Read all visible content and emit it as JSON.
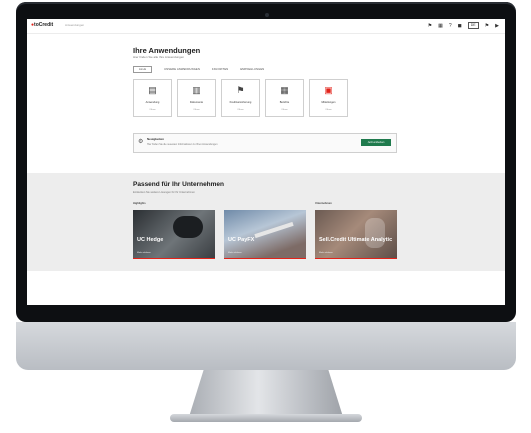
{
  "header": {
    "logo_mark": "●",
    "logo_text": "toCredit",
    "breadcrumb": "Anwendungen",
    "icons": [
      "flag-icon",
      "grid-icon",
      "help-icon",
      "account-icon"
    ],
    "icon_glyphs": [
      "⚑",
      "▦",
      "?",
      "◼"
    ],
    "language": "DE",
    "extra_glyphs": [
      "⚑",
      "▶"
    ]
  },
  "main": {
    "title": "Ihre Anwendungen",
    "subtitle": "Hier finden Sie alle Ihre Anwendungen",
    "tabs": [
      "ALLE",
      "UNSERE ANWENDUNGEN",
      "FAVORITEN",
      "EMPFEHLUNGEN"
    ],
    "cards": [
      {
        "name": "Anwendung",
        "meta": "Öffnen",
        "glyph": "▤"
      },
      {
        "name": "Dokumente",
        "meta": "Öffnen",
        "glyph": "▥"
      },
      {
        "name": "Kreditversicherung",
        "meta": "Öffnen",
        "glyph": "⚑"
      },
      {
        "name": "Berichte",
        "meta": "Öffnen",
        "glyph": "▦"
      },
      {
        "name": "Mitteilungen",
        "meta": "Öffnen",
        "glyph": "▣"
      }
    ],
    "notice": {
      "glyph": "⚙",
      "title": "Neuigkeiten",
      "description": "Hier finden Sie die neuesten Informationen zu Ihren Anwendungen",
      "button": "Jetzt entdecken"
    }
  },
  "recommend": {
    "title": "Passend für Ihr Unternehmen",
    "description": "Entdecken Sie weitere Lösungen für Ihr Unternehmen",
    "groups": [
      "Highlights",
      "",
      "Unternehmen"
    ],
    "promos": [
      {
        "title": "UC Hedge",
        "sub": "Mehr erfahren"
      },
      {
        "title": "UC PayFX",
        "sub": "Mehr erfahren"
      },
      {
        "title": "Sell.Credit Ultimate Analytic",
        "sub": "Mehr erfahren"
      }
    ]
  },
  "colors": {
    "brand": "#e2231a",
    "button": "#1f7a4d"
  }
}
